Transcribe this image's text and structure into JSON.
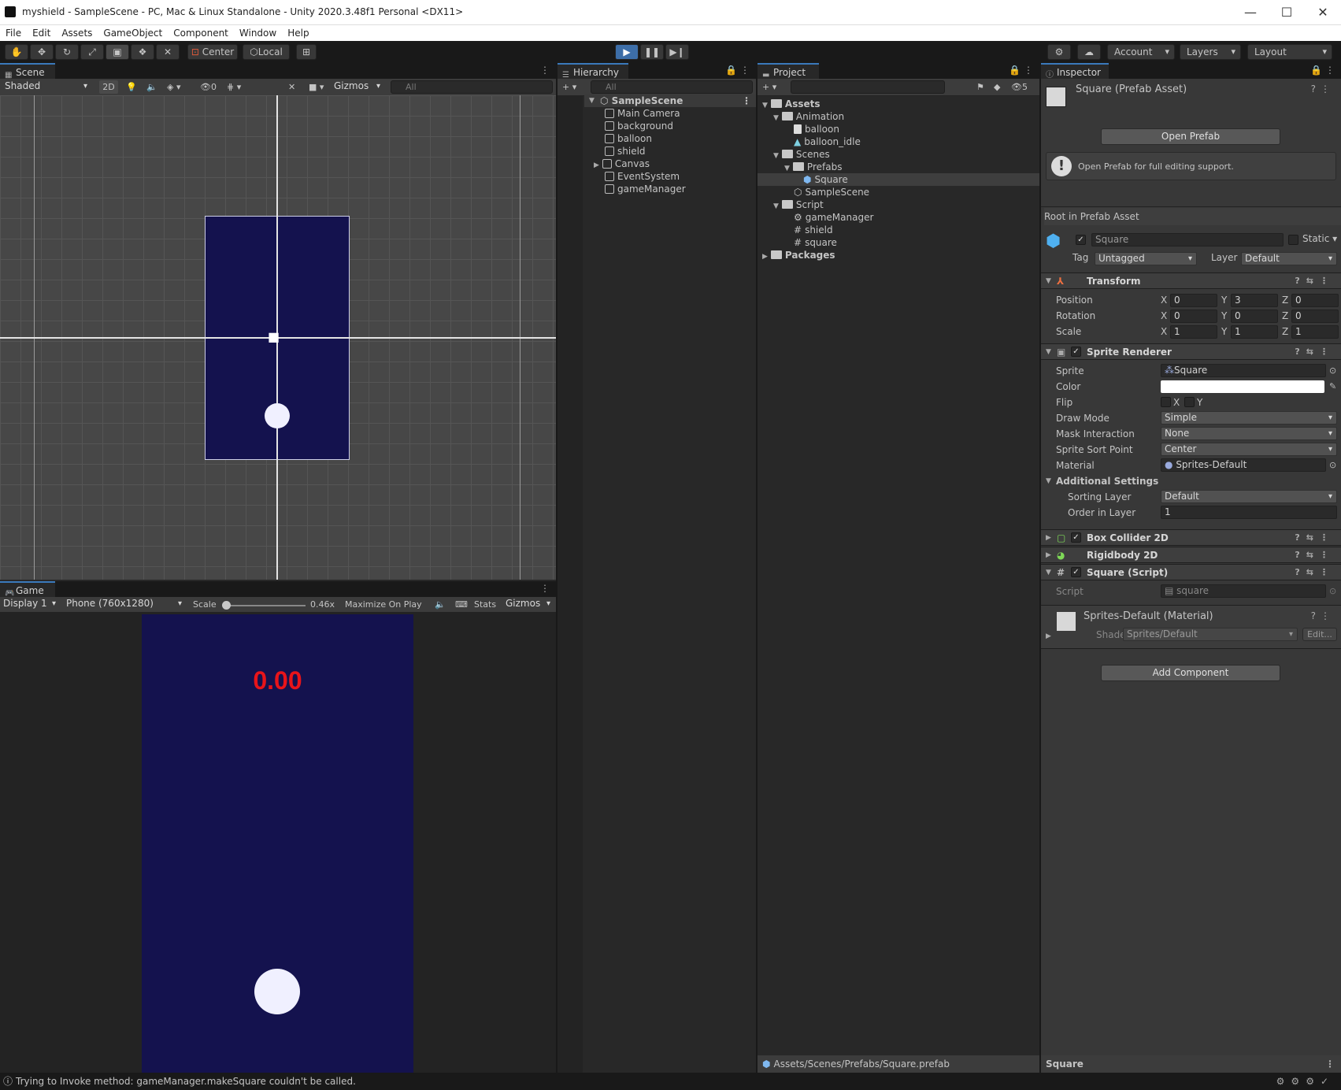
{
  "window": {
    "title": "myshield - SampleScene - PC, Mac & Linux Standalone - Unity 2020.3.48f1 Personal <DX11>"
  },
  "menu": [
    "File",
    "Edit",
    "Assets",
    "GameObject",
    "Component",
    "Window",
    "Help"
  ],
  "toolbar": {
    "center": "Center",
    "local": "Local",
    "account": "Account",
    "layers": "Layers",
    "layout": "Layout"
  },
  "scene": {
    "tab": "Scene",
    "shading": "Shaded",
    "mode_2d": "2D",
    "hidden_count": "0",
    "gizmos": "Gizmos",
    "search_placeholder": "All"
  },
  "game": {
    "tab": "Game",
    "display": "Display 1",
    "resolution": "Phone (760x1280)",
    "scale_label": "Scale",
    "scale_value": "0.46x",
    "maximize": "Maximize On Play",
    "stats": "Stats",
    "gizmos": "Gizmos",
    "score": "0.00"
  },
  "hierarchy": {
    "tab": "Hierarchy",
    "search_placeholder": "All",
    "scene": "SampleScene",
    "items": [
      "Main Camera",
      "background",
      "balloon",
      "shield",
      "Canvas",
      "EventSystem",
      "gameManager"
    ]
  },
  "project": {
    "tab": "Project",
    "hidden_count": "5",
    "tree": {
      "assets": "Assets",
      "animation": "Animation",
      "balloon": "balloon",
      "balloon_idle": "balloon_idle",
      "scenes": "Scenes",
      "prefabs": "Prefabs",
      "square": "Square",
      "samplescene": "SampleScene",
      "script": "Script",
      "gameManager": "gameManager",
      "shield": "shield",
      "square_script": "square",
      "packages": "Packages"
    },
    "path": "Assets/Scenes/Prefabs/Square.prefab"
  },
  "inspector": {
    "tab": "Inspector",
    "asset_title": "Square (Prefab Asset)",
    "open_prefab": "Open Prefab",
    "help_text": "Open Prefab for full editing support.",
    "root_label": "Root in Prefab Asset",
    "object_name": "Square",
    "static_label": "Static",
    "tag_label": "Tag",
    "tag_value": "Untagged",
    "layer_label": "Layer",
    "layer_value": "Default",
    "transform": {
      "title": "Transform",
      "position_label": "Position",
      "px": "0",
      "py": "3",
      "pz": "0",
      "rotation_label": "Rotation",
      "rx": "0",
      "ry": "0",
      "rz": "0",
      "scale_label": "Scale",
      "sx": "1",
      "sy": "1",
      "sz": "1"
    },
    "sprite_renderer": {
      "title": "Sprite Renderer",
      "sprite_label": "Sprite",
      "sprite_value": "Square",
      "color_label": "Color",
      "flip_label": "Flip",
      "flip_x": "X",
      "flip_y": "Y",
      "draw_mode_label": "Draw Mode",
      "draw_mode_value": "Simple",
      "mask_label": "Mask Interaction",
      "mask_value": "None",
      "sort_point_label": "Sprite Sort Point",
      "sort_point_value": "Center",
      "material_label": "Material",
      "material_value": "Sprites-Default",
      "additional_label": "Additional Settings",
      "sorting_layer_label": "Sorting Layer",
      "sorting_layer_value": "Default",
      "order_label": "Order in Layer",
      "order_value": "1"
    },
    "box_collider": "Box Collider 2D",
    "rigidbody": "Rigidbody 2D",
    "square_script": {
      "title": "Square (Script)",
      "script_label": "Script",
      "script_value": "square"
    },
    "material": {
      "title": "Sprites-Default (Material)",
      "shader_label": "Shader",
      "shader_value": "Sprites/Default",
      "edit": "Edit..."
    },
    "add_component": "Add Component",
    "footer": "Square"
  },
  "status": {
    "message": "Trying to Invoke method: gameManager.makeSquare couldn't be called."
  },
  "colors": {
    "accent": "#3a79bb",
    "game_bg": "#14124e",
    "score": "#e8141a"
  }
}
